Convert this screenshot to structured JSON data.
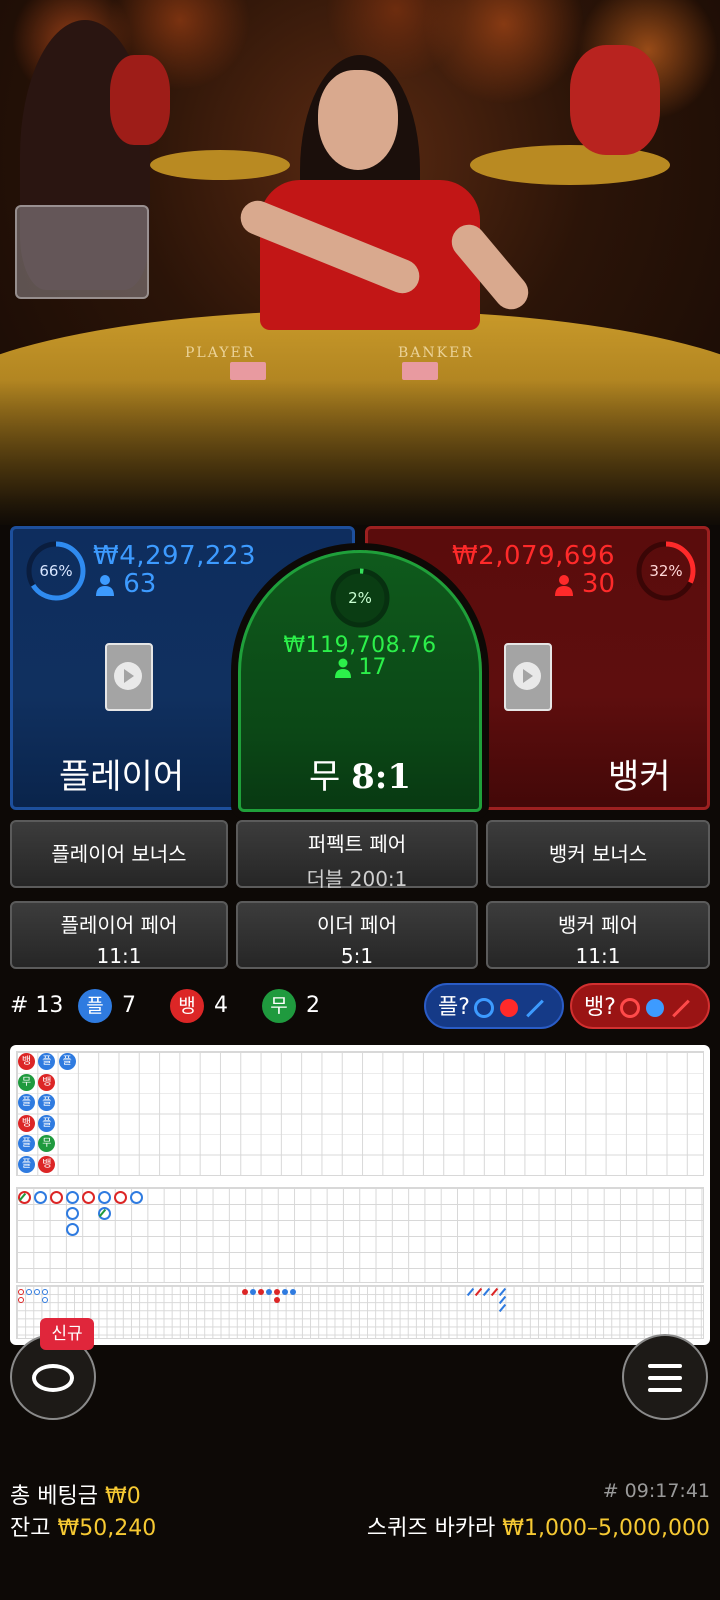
{
  "stats_values": {
    "player": {
      "amount": "₩4,297,223",
      "bettors": "63",
      "percent": "66%",
      "percent_value": 66
    },
    "tie": {
      "amount": "₩119,708.76",
      "bettors": "17",
      "percent": "2%",
      "percent_value": 2
    },
    "banker": {
      "amount": "₩2,079,696",
      "bettors": "30",
      "percent": "32%",
      "percent_value": 32
    }
  },
  "spots": {
    "player_label": "플레이어",
    "tie_label": "무",
    "tie_odds": "8:1",
    "banker_label": "뱅커"
  },
  "side_bets": {
    "player_bonus": "플레이어 보너스",
    "perfect_pair": "퍼펙트 페어",
    "perfect_pair_odds": "더블 200:1",
    "banker_bonus": "뱅커 보너스",
    "player_pair": "플레이어 페어",
    "player_pair_odds": "11:1",
    "either_pair": "이더 페어",
    "either_pair_odds": "5:1",
    "banker_pair": "뱅커 페어",
    "banker_pair_odds": "11:1"
  },
  "history": {
    "round": "# 13",
    "player_badge": "플",
    "player_count": "7",
    "banker_badge": "뱅",
    "banker_count": "4",
    "tie_badge": "무",
    "tie_count": "2",
    "ask_player": "플?",
    "ask_banker": "뱅?"
  },
  "bead_road": [
    [
      "뱅",
      "무",
      "플",
      "뱅",
      "플",
      "플"
    ],
    [
      "플",
      "뱅",
      "플",
      "플",
      "무",
      "뱅"
    ],
    [
      "플"
    ]
  ],
  "colors": {
    "player": "#2f7be0",
    "banker": "#dc2626",
    "tie": "#1f9a3e",
    "gold": "#f6c933"
  },
  "bottom": {
    "new_badge": "신규",
    "total_bet_label": "총 베팅금",
    "total_bet_value": "₩0",
    "balance_label": "잔고",
    "balance_value": "₩50,240",
    "game_id": "# 09:17:41",
    "table_name": "스퀴즈 바카라",
    "limits": "₩1,000–5,000,000"
  },
  "icons": {
    "chat": "chat-icon",
    "menu": "hamburger-menu-icon",
    "card": "card-placeholder-icon",
    "person": "person-icon"
  },
  "video": {
    "felt_player": "PLAYER",
    "felt_banker": "BANKER"
  }
}
